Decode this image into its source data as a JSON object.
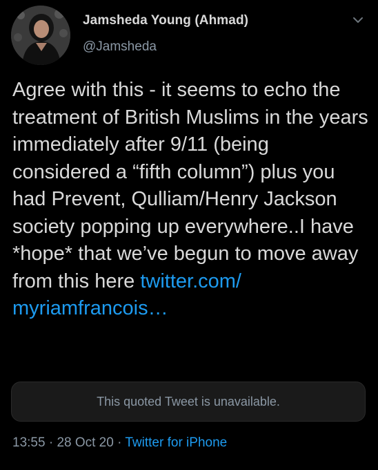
{
  "author": {
    "display_name": "Jamsheda Young (Ahmad)",
    "handle": "@Jamsheda"
  },
  "tweet": {
    "text_before_link": "Agree with this - it seems to echo the treatment of British Muslims in the years immediately after 9/11 (being considered a “fifth column”) plus you had Prevent, Qulliam/Henry Jackson society popping up everywhere..I have *hope* that we’ve begun to move away from this here ",
    "link_line1": "twitter.com/",
    "link_line2": "myriamfrancois…"
  },
  "quoted_tweet": {
    "text": "This quoted Tweet is unavailable."
  },
  "meta": {
    "time": "13:55",
    "sep1": " · ",
    "date": "28 Oct 20",
    "sep2": " · ",
    "source": "Twitter for iPhone"
  },
  "icons": {
    "menu": "chevron-down-icon",
    "avatar": "avatar"
  },
  "colors": {
    "background": "#000000",
    "text": "#d9d9d9",
    "secondary": "#8b98a5",
    "link": "#1d9bf0"
  }
}
